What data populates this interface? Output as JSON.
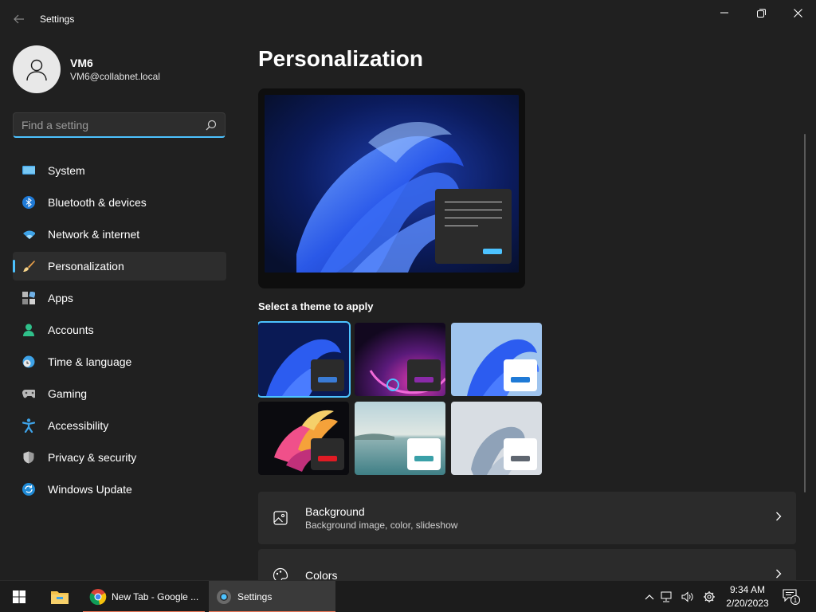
{
  "window": {
    "title": "Settings"
  },
  "profile": {
    "name": "VM6",
    "email": "VM6@collabnet.local"
  },
  "search": {
    "placeholder": "Find a setting"
  },
  "nav": {
    "items": [
      {
        "label": "System",
        "icon": "monitor-icon"
      },
      {
        "label": "Bluetooth & devices",
        "icon": "bluetooth-icon"
      },
      {
        "label": "Network & internet",
        "icon": "wifi-icon"
      },
      {
        "label": "Personalization",
        "icon": "brush-icon",
        "active": true
      },
      {
        "label": "Apps",
        "icon": "apps-icon"
      },
      {
        "label": "Accounts",
        "icon": "person-icon"
      },
      {
        "label": "Time & language",
        "icon": "clock-globe-icon"
      },
      {
        "label": "Gaming",
        "icon": "gamepad-icon"
      },
      {
        "label": "Accessibility",
        "icon": "accessibility-icon"
      },
      {
        "label": "Privacy & security",
        "icon": "shield-icon"
      },
      {
        "label": "Windows Update",
        "icon": "update-icon"
      }
    ]
  },
  "main": {
    "title": "Personalization",
    "themes_label": "Select a theme to apply",
    "themes": [
      {
        "name": "windows-dark",
        "selected": true,
        "accent": "#3a7bd5"
      },
      {
        "name": "glow",
        "selected": false,
        "accent": "#8a2aa8"
      },
      {
        "name": "windows-light",
        "selected": false,
        "accent": "#1f7ad6"
      },
      {
        "name": "captured-motion",
        "selected": false,
        "accent": "#e01b24"
      },
      {
        "name": "sunrise",
        "selected": false,
        "accent": "#3aa0a8"
      },
      {
        "name": "flow",
        "selected": false,
        "accent": "#5f6670"
      }
    ],
    "cards": [
      {
        "title": "Background",
        "subtitle": "Background image, color, slideshow",
        "icon": "image-icon"
      },
      {
        "title": "Colors",
        "subtitle": "",
        "icon": "palette-icon"
      }
    ]
  },
  "taskbar": {
    "apps": [
      {
        "label": "New Tab - Google ...",
        "icon": "chrome-icon"
      },
      {
        "label": "Settings",
        "icon": "settings-gear-icon",
        "active": true
      }
    ],
    "time": "9:34 AM",
    "date": "2/20/2023",
    "notification_count": "1"
  },
  "colors": {
    "accent": "#4cc2ff",
    "background": "#202020",
    "card": "#2b2b2b"
  }
}
